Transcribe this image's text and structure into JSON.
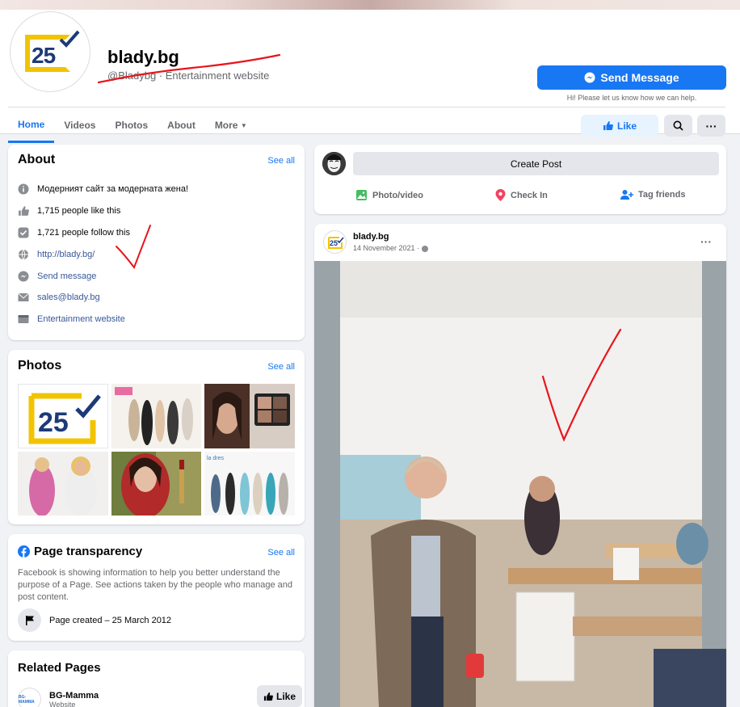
{
  "header": {
    "page_name": "blady.bg",
    "page_sub": "@Bladybg · Entertainment website",
    "message_button": "Send Message",
    "message_hint": "Hi! Please let us know how we can help.",
    "like_button": "Like",
    "more_dots": "···",
    "logo_number": "25"
  },
  "tabs": [
    "Home",
    "Videos",
    "Photos",
    "About",
    "More"
  ],
  "about": {
    "title": "About",
    "see_all": "See all",
    "rows": {
      "description": "Модерният сайт за модерната жена!",
      "likes": "1,715 people like this",
      "follows": "1,721 people follow this",
      "website": "http://blady.bg/",
      "send_message": "Send message",
      "email": "sales@blady.bg",
      "category": "Entertainment website"
    }
  },
  "photos": {
    "title": "Photos",
    "see_all": "See all"
  },
  "transparency": {
    "title": "Page transparency",
    "see_all": "See all",
    "text": "Facebook is showing information to help you better understand the purpose of a Page. See actions taken by the people who manage and post content.",
    "created": "Page created – 25 March 2012"
  },
  "related": {
    "title": "Related Pages",
    "page_name": "BG-Mamma",
    "page_sub": "Website",
    "like_button": "Like"
  },
  "create_post": {
    "button": "Create Post",
    "photo_video": "Photo/video",
    "check_in": "Check In",
    "tag_friends": "Tag friends"
  },
  "post": {
    "author": "blady.bg",
    "date": "14 November 2021 · ",
    "more": "···"
  },
  "colors": {
    "accent": "#1877f2",
    "annotation": "#e8141b"
  }
}
